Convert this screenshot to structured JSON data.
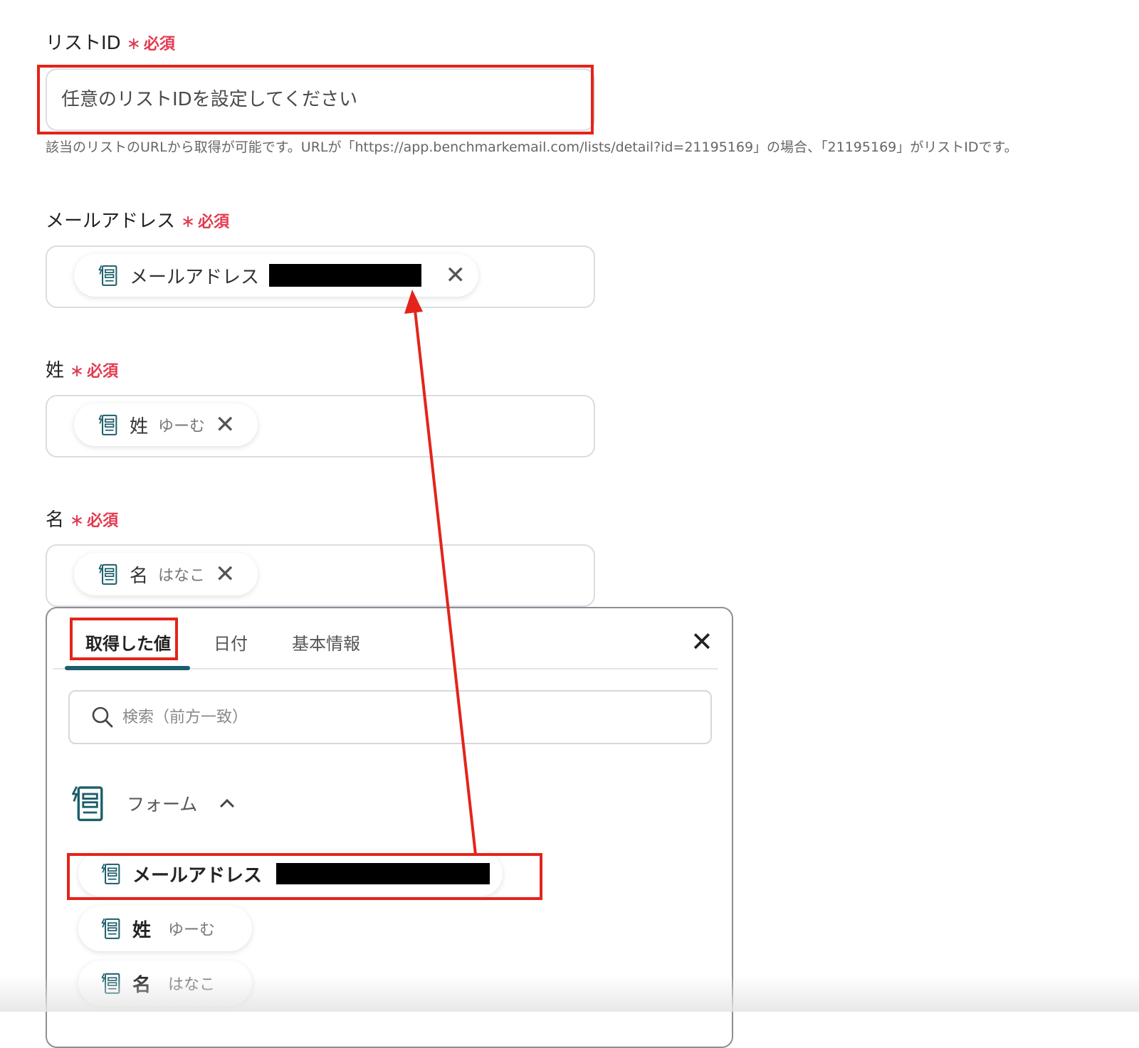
{
  "fields": {
    "list_id": {
      "label": "リストID",
      "required_mark": "∗",
      "required_text": "必須",
      "placeholder": "任意のリストIDを設定してください",
      "help": "該当のリストのURLから取得が可能です。URLが「https://app.benchmarkemail.com/lists/detail?id=21195169」の場合、「21195169」がリストIDです。"
    },
    "email": {
      "label": "メールアドレス",
      "required_mark": "∗",
      "required_text": "必須",
      "chip": {
        "name": "メールアドレス",
        "value": ""
      }
    },
    "last_name": {
      "label": "姓",
      "required_mark": "∗",
      "required_text": "必須",
      "chip": {
        "name": "姓",
        "value": "ゆーむ"
      }
    },
    "first_name": {
      "label": "名",
      "required_mark": "∗",
      "required_text": "必須",
      "chip": {
        "name": "名",
        "value": "はなこ"
      }
    }
  },
  "panel": {
    "tabs": [
      {
        "label": "取得した値",
        "active": true
      },
      {
        "label": "日付",
        "active": false
      },
      {
        "label": "基本情報",
        "active": false
      }
    ],
    "search_placeholder": "検索（前方一致）",
    "group": {
      "label": "フォーム",
      "expanded": true
    },
    "items": [
      {
        "name": "メールアドレス",
        "value": ""
      },
      {
        "name": "姓",
        "value": "ゆーむ"
      },
      {
        "name": "名",
        "value": "はなこ"
      }
    ]
  },
  "icons": {
    "form_chip": "form-document-icon",
    "remove": "close-icon",
    "panel_close": "close-icon",
    "search": "search-icon",
    "collapse": "chevron-up-icon"
  },
  "colors": {
    "required": "#e23a4f",
    "highlight_box": "#e3241b",
    "tab_underline": "#1b5e6b",
    "icon": "#1b5e6b"
  }
}
